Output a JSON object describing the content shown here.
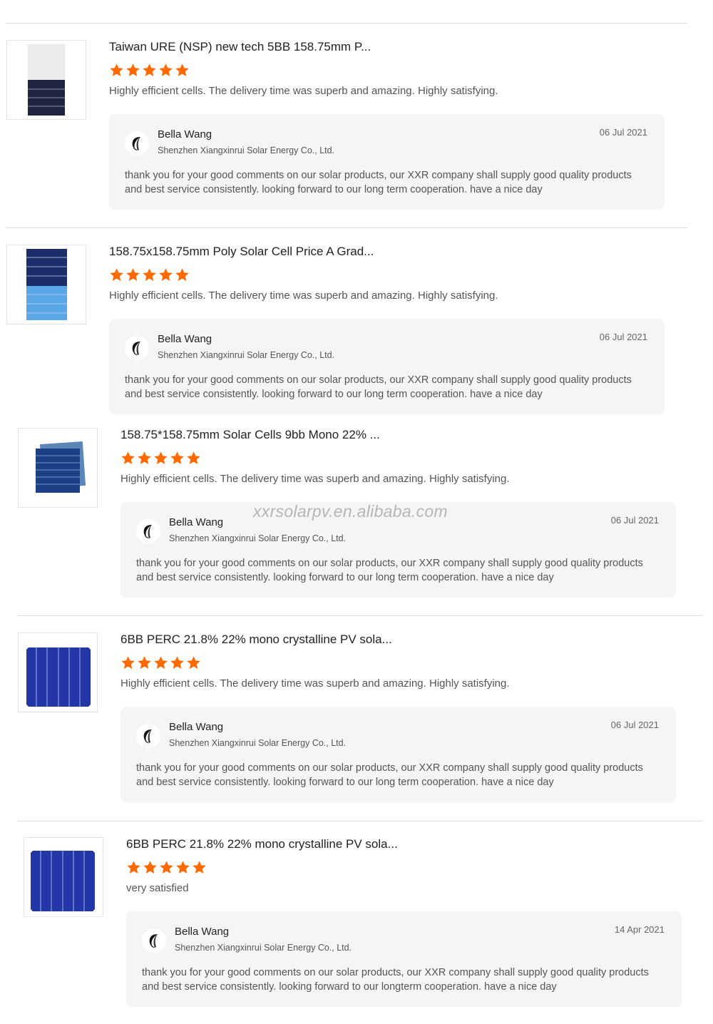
{
  "watermark": "xxrsolarpv.en.alibaba.com",
  "colors": {
    "star": "#ff6a00",
    "reply_bg": "#f5f5f5"
  },
  "reviews": [
    {
      "title": "Taiwan URE (NSP) new tech 5BB 158.75mm P...",
      "rating": 5,
      "text": "Highly efficient cells. The delivery time was superb and amazing. Highly satisfying.",
      "reply": {
        "name": "Bella Wang",
        "company": "Shenzhen Xiangxinrui Solar Energy Co., Ltd.",
        "date": "06 Jul 2021",
        "body": "thank you for your good comments on our solar products, our XXR company shall supply good quality products and best service consistently. looking forward to our long term cooperation. have a nice day"
      }
    },
    {
      "title": "158.75x158.75mm Poly Solar Cell Price A Grad...",
      "rating": 5,
      "text": "Highly efficient cells. The delivery time was superb and amazing. Highly satisfying.",
      "reply": {
        "name": "Bella Wang",
        "company": "Shenzhen Xiangxinrui Solar Energy Co., Ltd.",
        "date": "06 Jul 2021",
        "body": "thank you for your good comments on our solar products, our XXR company shall supply good quality products and best service consistently. looking forward to our long term cooperation. have a nice day"
      }
    },
    {
      "title": "158.75*158.75mm Solar Cells 9bb Mono 22% ...",
      "rating": 5,
      "text": "Highly efficient cells. The delivery time was superb and amazing. Highly satisfying.",
      "reply": {
        "name": "Bella Wang",
        "company": "Shenzhen Xiangxinrui Solar Energy Co., Ltd.",
        "date": "06 Jul 2021",
        "body": "thank you for your good comments on our solar products, our XXR company shall supply good quality products and best service consistently. looking forward to our long term cooperation. have a nice day"
      }
    },
    {
      "title": "6BB PERC 21.8% 22% mono crystalline PV sola...",
      "rating": 5,
      "text": "Highly efficient cells. The delivery time was superb and amazing. Highly satisfying.",
      "reply": {
        "name": "Bella Wang",
        "company": "Shenzhen Xiangxinrui Solar Energy Co., Ltd.",
        "date": "06 Jul 2021",
        "body": "thank you for your good comments on our solar products, our XXR company shall supply good quality products and best service consistently. looking forward to our long term cooperation. have a nice day"
      }
    },
    {
      "title": "6BB PERC 21.8% 22% mono crystalline PV sola...",
      "rating": 5,
      "text": "very satisfied",
      "reply": {
        "name": "Bella Wang",
        "company": "Shenzhen Xiangxinrui Solar Energy Co., Ltd.",
        "date": "14 Apr 2021",
        "body": "thank you for your good comments on our solar products, our XXR company shall supply good quality products and best service consistently. looking forward to our longterm cooperation. have a nice day"
      }
    }
  ]
}
